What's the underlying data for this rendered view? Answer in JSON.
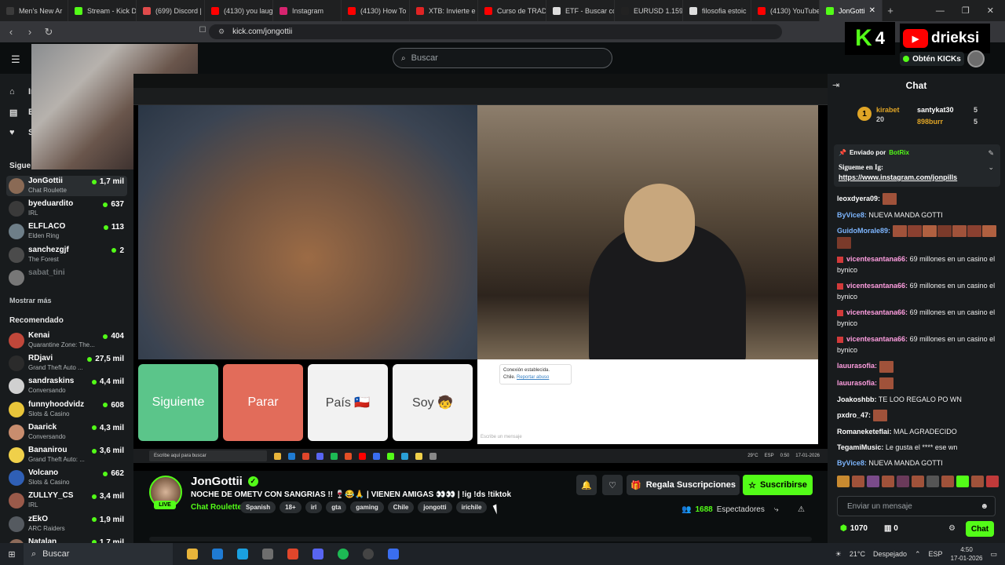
{
  "browser": {
    "tabs": [
      {
        "title": "Men's New Ar",
        "color": "#3b3b3b"
      },
      {
        "title": "Stream - Kick D",
        "color": "#53fc18"
      },
      {
        "title": "(699) Discord |",
        "color": "#e04b4b"
      },
      {
        "title": "(4130) you laug",
        "color": "#ff0000"
      },
      {
        "title": "Instagram",
        "color": "#d6246f"
      },
      {
        "title": "(4130) How To",
        "color": "#ff0000"
      },
      {
        "title": "XTB: Invierte e",
        "color": "#e02424"
      },
      {
        "title": "Curso de TRAD",
        "color": "#ff0000"
      },
      {
        "title": "ETF - Buscar co",
        "color": "#dddddd"
      },
      {
        "title": "EURUSD 1.159",
        "color": "#222222"
      },
      {
        "title": "filosofia estoic",
        "color": "#dddddd"
      },
      {
        "title": "(4130) YouTube",
        "color": "#ff0000"
      }
    ],
    "active_tab": {
      "title": "JonGotti",
      "color": "#53fc18"
    },
    "url": "kick.com/jongottii"
  },
  "kick": {
    "search_placeholder": "Buscar",
    "k4_label": "K",
    "k4_num": "4",
    "yt_name": "drieksi",
    "get_kicks": "Obtén KICKs"
  },
  "sidebar": {
    "nav": [
      {
        "label": "In",
        "icon": "⌂"
      },
      {
        "label": "E",
        "icon": "▤"
      },
      {
        "label": "S",
        "icon": "♥"
      }
    ],
    "following_label": "Sigue",
    "following": [
      {
        "name": "JonGottii",
        "category": "Chat Roulette",
        "viewers": "1,7 mil",
        "avatar": "#8a6a55",
        "selected": true
      },
      {
        "name": "byeduardito",
        "category": "IRL",
        "viewers": "637",
        "avatar": "#3a3a3a"
      },
      {
        "name": "ELFLACO",
        "category": "Elden Ring",
        "viewers": "113",
        "avatar": "#6e7e88"
      },
      {
        "name": "sanchezgjf",
        "category": "The Forest",
        "viewers": "2",
        "avatar": "#4b4b4b"
      },
      {
        "name": "sabat_tini",
        "category": "",
        "viewers": "",
        "avatar": "#777777",
        "offline": true
      }
    ],
    "show_more": "Mostrar más",
    "recommended_label": "Recomendado",
    "recommended": [
      {
        "name": "Kenai",
        "category": "Quarantine Zone: The...",
        "viewers": "404",
        "avatar": "#c0473a"
      },
      {
        "name": "RDjavi",
        "category": "Grand Theft Auto ...",
        "viewers": "27,5 mil",
        "avatar": "#2b2b2b"
      },
      {
        "name": "sandraskins",
        "category": "Conversando",
        "viewers": "4,4 mil",
        "avatar": "#d0d0d0"
      },
      {
        "name": "funnyhoodvidz",
        "category": "Slots & Casino",
        "viewers": "608",
        "avatar": "#e9c53a"
      },
      {
        "name": "Daarick",
        "category": "Conversando",
        "viewers": "4,3 mil",
        "avatar": "#c88d6e"
      },
      {
        "name": "Bananirou",
        "category": "Grand Theft Auto: ...",
        "viewers": "3,6 mil",
        "avatar": "#f0d04a"
      },
      {
        "name": "Volcano",
        "category": "Slots & Casino",
        "viewers": "662",
        "avatar": "#2f5fb5"
      },
      {
        "name": "ZULLYY_CS",
        "category": "IRL",
        "viewers": "3,4 mil",
        "avatar": "#9a5a4a"
      },
      {
        "name": "zEkO",
        "category": "ARC Raiders",
        "viewers": "1,9 mil",
        "avatar": "#555a60"
      },
      {
        "name": "Natalan",
        "category": "",
        "viewers": "1,7 mil",
        "avatar": "#8d6b5a"
      }
    ]
  },
  "video": {
    "btn_next": "Siguiente",
    "btn_stop": "Parar",
    "btn_country": "País 🇨🇱",
    "btn_soy": "Soy 🧒",
    "toast_line1": "Conexión establecida.",
    "toast_line2": "Chile.",
    "toast_link": "Reportar abuso",
    "msg_placeholder": "Escribe un mensaje",
    "taskbar_search": "Escribe aquí para buscar",
    "taskbar_temp": "29°C",
    "taskbar_lang": "ESP",
    "taskbar_time": "0:50",
    "taskbar_date": "17-01-2026"
  },
  "stream": {
    "name": "JonGottii",
    "live": "LIVE",
    "title": "NOCHE DE OMETV CON SANGRIAS !! 🍷😂🙏 | VIENEN AMIGAS 👀👀 | !ig !ds !tiktok",
    "category": "Chat Roulette",
    "tags": [
      "Spanish",
      "18+",
      "irl",
      "gta",
      "gaming",
      "Chile",
      "jongotti",
      "irichile"
    ],
    "gift_label": "Regala Suscripciones",
    "subscribe_label": "Suscribirse",
    "viewers_count": "1688",
    "viewers_label": "Espectadores"
  },
  "chat": {
    "title": "Chat",
    "gifters": [
      {
        "rank": "1",
        "name": "kirabet",
        "count": "20",
        "color": "#e0a526"
      },
      {
        "name": "santykat30",
        "count": "5",
        "color": "#ffffff"
      },
      {
        "name": "898burr",
        "count": "5",
        "color": "#e0a526"
      }
    ],
    "pinned_by": "Enviado por",
    "pinned_bot": "BotRix",
    "pinned_line1": "Sigueme en Ig:",
    "pinned_link": "https://www.instagram.com/jonpills",
    "messages": [
      {
        "user": "leoxdyera09:",
        "text": "",
        "color": "#ffffff",
        "emotes": 1
      },
      {
        "user": "ByVice8:",
        "text": "NUEVA MANDA GOTTI",
        "color": "#7db6ff",
        "emotes": 0
      },
      {
        "user": "GuidoMorale89:",
        "text": "",
        "color": "#7db6ff",
        "emotes": 8
      },
      {
        "user": "vicentesantana66:",
        "text": "69 millones en un casino el bynico",
        "color": "#ff9ee0",
        "badge": true
      },
      {
        "user": "vicentesantana66:",
        "text": "69 millones en un casino el bynico",
        "color": "#ff9ee0",
        "badge": true
      },
      {
        "user": "vicentesantana66:",
        "text": "69 millones en un casino el bynico",
        "color": "#ff9ee0",
        "badge": true
      },
      {
        "user": "vicentesantana66:",
        "text": "69 millones en un casino el bynico",
        "color": "#ff9ee0",
        "badge": true
      },
      {
        "user": "lauurasofia:",
        "text": "",
        "color": "#ff9ee0",
        "emotes": 1
      },
      {
        "user": "lauurasofia:",
        "text": "",
        "color": "#ff9ee0",
        "emotes": 1
      },
      {
        "user": "Joakoshbb:",
        "text": "TE LOO REGALO PO WN",
        "color": "#ffffff"
      },
      {
        "user": "pxdro_47:",
        "text": "",
        "color": "#ffffff",
        "emotes": 1
      },
      {
        "user": "Romaneketeflai:",
        "text": "MAL AGRADECIDO",
        "color": "#ffffff"
      },
      {
        "user": "TegamiMusic:",
        "text": "Le gusta el **** ese wn",
        "color": "#ffffff"
      },
      {
        "user": "ByVice8:",
        "text": "NUEVA MANDA GOTTI",
        "color": "#7db6ff"
      }
    ],
    "input_placeholder": "Enviar un mensaje",
    "points": "1070",
    "chest_count": "0",
    "send_label": "Chat"
  },
  "taskbar": {
    "search": "Buscar",
    "weather": "21°C",
    "weather_label": "Despejado",
    "lang": "ESP",
    "time": "4:50",
    "date": "17-01-2026"
  }
}
